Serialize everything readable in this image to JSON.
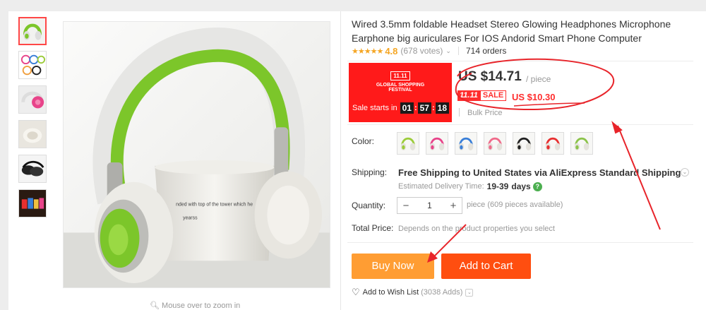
{
  "product": {
    "title": "Wired 3.5mm foldable Headset Stereo Glowing Headphones Microphone Earphone big auriculares For IOS Andorid Smart Phone Computer",
    "rating_stars": "★★★★★",
    "rating": "4.8",
    "votes": "(678 votes)",
    "orders": "714 orders"
  },
  "gallery": {
    "zoom_hint": "Mouse over to zoom in",
    "image_text_1": "nded with top of the tower which he",
    "image_text_2": "yearss"
  },
  "promo": {
    "logo": "11.11",
    "line1": "GLOBAL SHOPPING",
    "line2": "FESTIVAL",
    "countdown_label": "Sale starts in",
    "hours": "01",
    "minutes": "57",
    "seconds": "18"
  },
  "price": {
    "main": "US $14.71",
    "unit": "/ piece",
    "tag_event": "11.11",
    "tag_sale": "SALE",
    "sale_price": "US $10.30",
    "bulk": "Bulk Price"
  },
  "options": {
    "color_label": "Color:",
    "shipping_label": "Shipping:",
    "shipping_text": "Free Shipping to United States via AliExpress Standard Shipping",
    "delivery_label": "Estimated Delivery Time:",
    "delivery_days": "19-39",
    "delivery_unit": "days",
    "quantity_label": "Quantity:",
    "quantity_value": "1",
    "quantity_minus": "−",
    "quantity_plus": "+",
    "quantity_info": "piece (609 pieces available)",
    "total_label": "Total Price:",
    "total_info": "Depends on the product properties you select"
  },
  "actions": {
    "buy_now": "Buy Now",
    "add_to_cart": "Add to Cart",
    "wishlist": "Add to Wish List",
    "wishlist_count": "(3038 Adds)"
  },
  "colors": {
    "accent_red": "#ff1a1a",
    "buy_now": "#ff9d33",
    "add_to_cart": "#ff4e10",
    "star": "#f5a623",
    "annotation": "#e8242a",
    "headphone_green": "#7cc62a"
  },
  "swatches": [
    {
      "name": "green",
      "color": "#9ccc3a"
    },
    {
      "name": "pink",
      "color": "#e8448a"
    },
    {
      "name": "blue",
      "color": "#3a7fd8"
    },
    {
      "name": "rose",
      "color": "#f06a8a"
    },
    {
      "name": "black",
      "color": "#222222"
    },
    {
      "name": "red",
      "color": "#e83030"
    },
    {
      "name": "lime",
      "color": "#8bc34a"
    }
  ]
}
